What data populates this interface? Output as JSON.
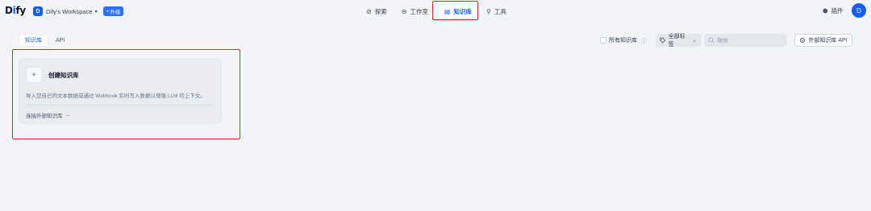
{
  "app": {
    "logo": {
      "prefix": "D",
      "accent": "i",
      "suffix": "fy"
    },
    "workspace": {
      "avatar": "D",
      "name": "Dify's Workspace",
      "chevron": "▾",
      "upgrade_icon": "+",
      "upgrade_label": "升级"
    },
    "nav": [
      {
        "icon": "explore-icon",
        "glyph": "⊘",
        "label": "探索"
      },
      {
        "icon": "studio-icon",
        "glyph": "⊖",
        "label": "工作室"
      },
      {
        "icon": "knowledge-icon",
        "glyph": "▤",
        "label": "知识库"
      },
      {
        "icon": "tools-icon",
        "glyph": "⚲",
        "label": "工具"
      }
    ],
    "plugins": {
      "icon": "plugin-icon",
      "glyph": "⬢",
      "label": "插件"
    },
    "user_avatar": "D"
  },
  "toolbar": {
    "tabs": [
      {
        "label": "知识库"
      },
      {
        "label": "API"
      }
    ],
    "all_kb_label": "所有知识库",
    "help_glyph": "ⓘ",
    "tags_label": "全部标签",
    "tags_chevron": "⌄",
    "search": {
      "placeholder": "搜索"
    },
    "ext_api_label": "外部知识库 API"
  },
  "card": {
    "plus": "+",
    "title": "创建知识库",
    "description": "导入您自己的文本数据或通过 Webhook 实时写入数据以增强 LLM 的上下文。",
    "link_label": "连接外部知识库",
    "link_arrow": "→"
  },
  "colors": {
    "accent": "#155eef",
    "highlight": "#e02424",
    "background": "#f2f4f7"
  }
}
